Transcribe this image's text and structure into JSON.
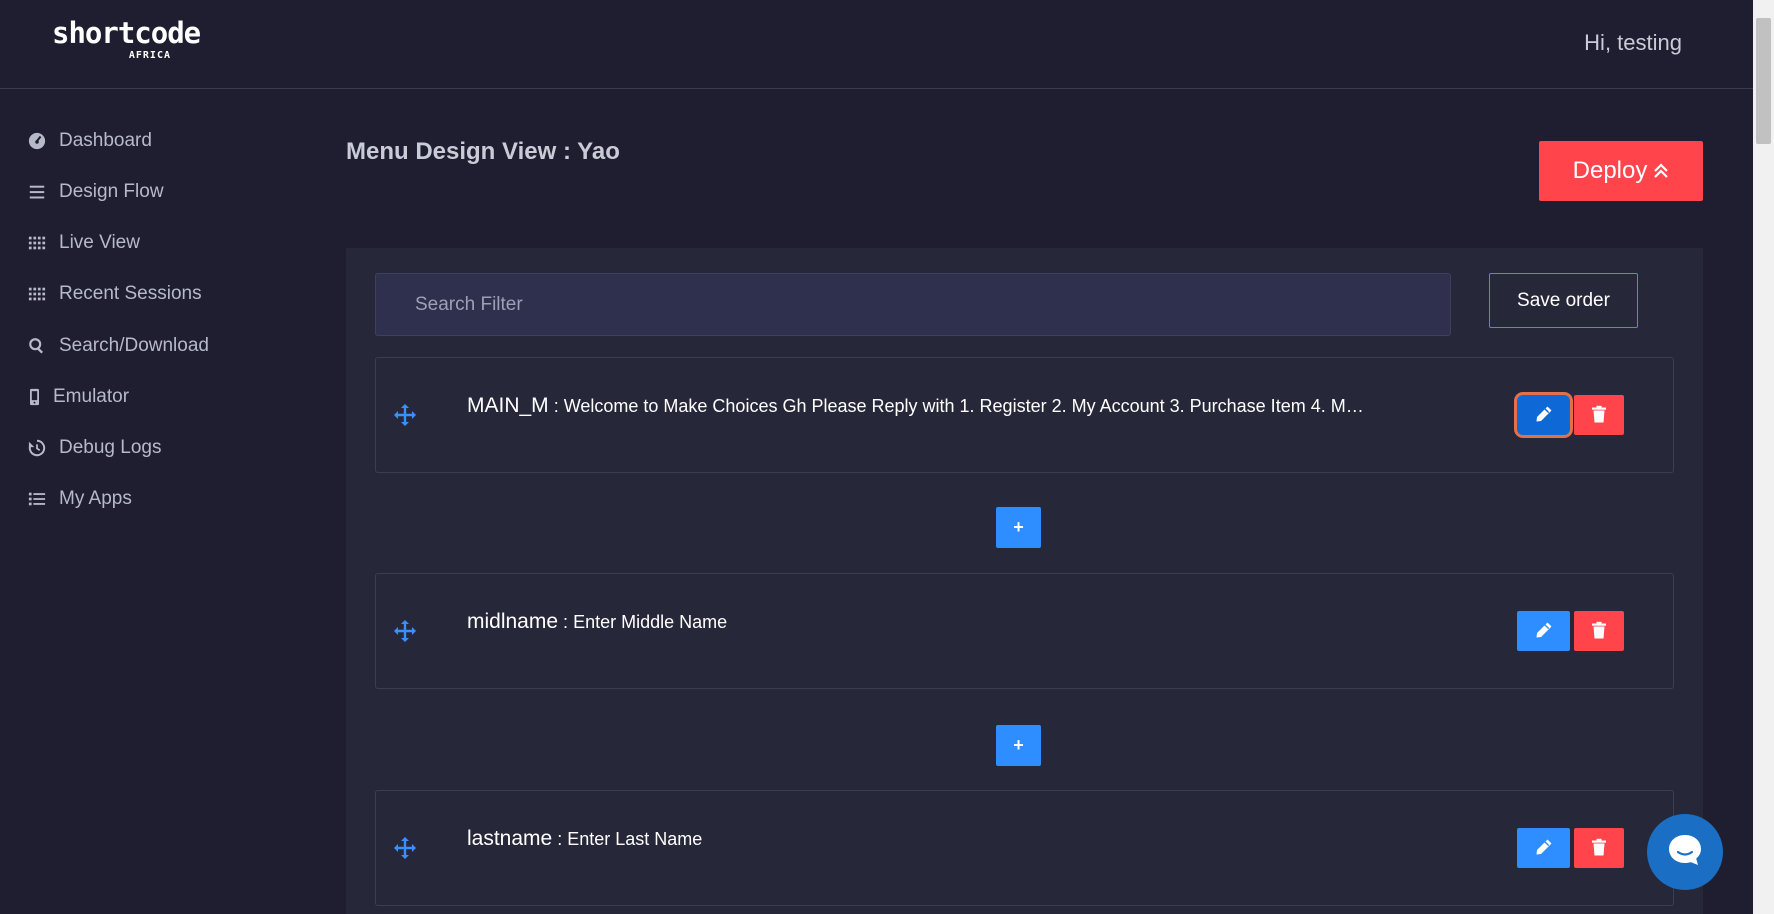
{
  "header": {
    "logo_main": "shortcode",
    "logo_sub": "AFRICA",
    "greeting": "Hi, testing"
  },
  "sidebar": {
    "items": [
      {
        "label": "Dashboard",
        "icon": "dashboard-icon"
      },
      {
        "label": "Design Flow",
        "icon": "bars-icon"
      },
      {
        "label": "Live View",
        "icon": "grid-icon"
      },
      {
        "label": "Recent Sessions",
        "icon": "grid-icon"
      },
      {
        "label": "Search/Download",
        "icon": "search-icon"
      },
      {
        "label": "Emulator",
        "icon": "mobile-icon"
      },
      {
        "label": "Debug Logs",
        "icon": "history-icon"
      },
      {
        "label": "My Apps",
        "icon": "list-icon"
      }
    ]
  },
  "main": {
    "title": "Menu Design View : Yao",
    "deploy_label": "Deploy",
    "search_placeholder": "Search Filter",
    "save_order_label": "Save order",
    "add_label": "+",
    "menus": [
      {
        "name": "MAIN_M",
        "separator": " : ",
        "text": "Welcome to Make Choices Gh Please Reply with 1. Register 2. My Account 3. Purchase Item 4. Ma...",
        "focused": true
      },
      {
        "name": "midlname",
        "separator": " : ",
        "text": "Enter Middle Name",
        "focused": false
      },
      {
        "name": "lastname",
        "separator": " : ",
        "text": "Enter Last Name",
        "focused": false
      }
    ]
  },
  "colors": {
    "background": "#1e1e30",
    "panel": "#262839",
    "accent_blue": "#2e8eff",
    "danger_red": "#ff444c",
    "chat_blue": "#1a6fc4"
  }
}
